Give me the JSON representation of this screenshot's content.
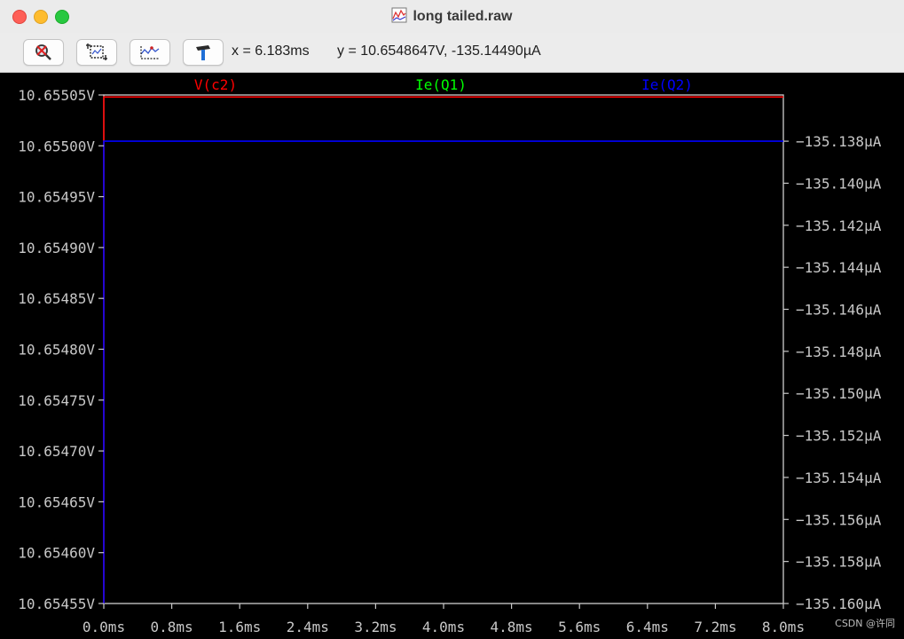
{
  "window": {
    "title": "long tailed.raw"
  },
  "toolbar": {
    "buttons": [
      {
        "name": "autorange-button",
        "icon": "magnifier-cross-icon"
      },
      {
        "name": "zoom-box-button",
        "icon": "zoom-box-icon"
      },
      {
        "name": "pan-button",
        "icon": "pan-trace-icon"
      },
      {
        "name": "settings-button",
        "icon": "hammer-icon"
      }
    ],
    "cursor_x": "x = 6.183ms",
    "cursor_y": "y = 10.6548647V, -135.14490µA"
  },
  "chart_data": {
    "type": "line",
    "title": "",
    "x_ticks": [
      "0.0ms",
      "0.8ms",
      "1.6ms",
      "2.4ms",
      "3.2ms",
      "4.0ms",
      "4.8ms",
      "5.6ms",
      "6.4ms",
      "7.2ms",
      "8.0ms"
    ],
    "xlim": [
      0,
      8
    ],
    "xunit": "ms",
    "y_left": {
      "ticks": [
        "10.65505V",
        "10.65500V",
        "10.65495V",
        "10.65490V",
        "10.65485V",
        "10.65480V",
        "10.65475V",
        "10.65470V",
        "10.65465V",
        "10.65460V",
        "10.65455V"
      ],
      "lim": [
        10.65455,
        10.65505
      ]
    },
    "y_right": {
      "ticks": [
        "−135.138µA",
        "−135.140µA",
        "−135.142µA",
        "−135.144µA",
        "−135.146µA",
        "−135.148µA",
        "−135.150µA",
        "−135.152µA",
        "−135.154µA",
        "−135.156µA",
        "−135.158µA",
        "−135.160µA"
      ],
      "lim": [
        -135.16,
        -135.1358
      ]
    },
    "series": [
      {
        "name": "V(c2)",
        "color": "#ff0000",
        "axis": "left",
        "x": [
          0,
          0,
          8
        ],
        "y": [
          10.65455,
          10.655048,
          10.655048
        ]
      },
      {
        "name": "Ie(Q1)",
        "color": "#00ff00",
        "axis": "right",
        "x": [],
        "y": []
      },
      {
        "name": "Ie(Q2)",
        "color": "#0000ff",
        "axis": "right",
        "x": [
          0,
          0,
          8
        ],
        "y": [
          -135.16,
          -135.138,
          -135.138
        ]
      }
    ],
    "grid": false,
    "colors": {
      "background": "#000000",
      "frame": "#bfbfbf",
      "ticks": "#c8c8c8"
    }
  },
  "watermark": "CSDN @许同"
}
